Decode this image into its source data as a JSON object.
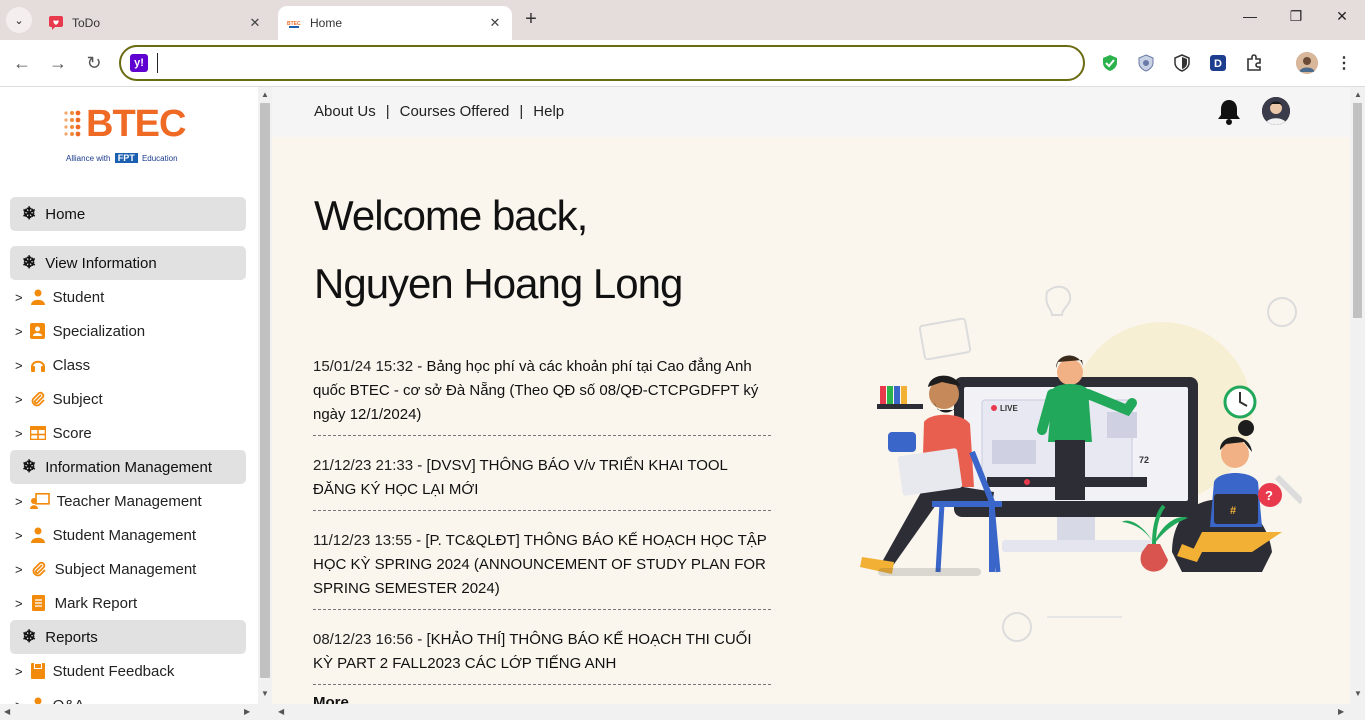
{
  "browser": {
    "tabs": [
      {
        "title": "ToDo",
        "icon": "chat-heart-icon",
        "close": "✕"
      },
      {
        "title": "Home",
        "icon": "btec-favicon",
        "close": "✕"
      }
    ],
    "new_tab": "+",
    "window_controls": {
      "minimize": "—",
      "maximize": "❐",
      "close": "✕"
    },
    "address_value": "",
    "search_engine_icon": "y!"
  },
  "sidebar": {
    "logo": {
      "main": "BTEC",
      "alliance": "Alliance with",
      "fpt": "FPT",
      "education": "Education"
    },
    "sections": [
      {
        "label": "Home"
      },
      {
        "label": "View Information"
      },
      {
        "label": "Information Management"
      },
      {
        "label": "Reports"
      }
    ],
    "items": [
      {
        "label": "Student",
        "icon": "person-icon"
      },
      {
        "label": "Specialization",
        "icon": "id-card-icon"
      },
      {
        "label": "Class",
        "icon": "headphones-icon"
      },
      {
        "label": "Subject",
        "icon": "paperclip-icon"
      },
      {
        "label": "Score",
        "icon": "table-icon"
      },
      {
        "label": "Teacher Management",
        "icon": "teacher-icon"
      },
      {
        "label": "Student Management",
        "icon": "person-icon"
      },
      {
        "label": "Subject Management",
        "icon": "paperclip-icon"
      },
      {
        "label": "Mark Report",
        "icon": "document-icon"
      },
      {
        "label": "Student Feedback",
        "icon": "feedback-icon"
      },
      {
        "label": "Q&A",
        "icon": "person-icon"
      }
    ]
  },
  "topnav": {
    "links": [
      "About Us",
      "Courses Offered",
      "Help"
    ],
    "separator": "|"
  },
  "main": {
    "welcome_line1": "Welcome back,",
    "welcome_line2": "Nguyen Hoang Long",
    "news": [
      {
        "date": "15/01/24 15:32",
        "title": "Bảng học phí và các khoản phí tại Cao đẳng Anh quốc BTEC - cơ sở Đà Nẵng (Theo QĐ số 08/QĐ-CTCPGDFPT ký ngày 12/1/2024)"
      },
      {
        "date": "21/12/23 21:33",
        "title": "[DVSV] THÔNG BÁO V/v TRIỂN KHAI TOOL ĐĂNG KÝ HỌC LẠI MỚI"
      },
      {
        "date": "11/12/23 13:55",
        "title": "[P. TC&QLĐT] THÔNG BÁO KẾ HOẠCH HỌC TẬP HỌC KỲ SPRING 2024 (ANNOUNCEMENT OF STUDY PLAN FOR SPRING SEMESTER 2024)"
      },
      {
        "date": "08/12/23 16:56",
        "title": "[KHẢO THÍ] THÔNG BÁO KẾ HOẠCH THI CUỐI KỲ PART 2 FALL2023 CÁC LỚP TIẾNG ANH"
      }
    ],
    "date_separator": " - ",
    "more": "More...",
    "illustration": {
      "live": "LIVE",
      "viewers": "72"
    }
  }
}
